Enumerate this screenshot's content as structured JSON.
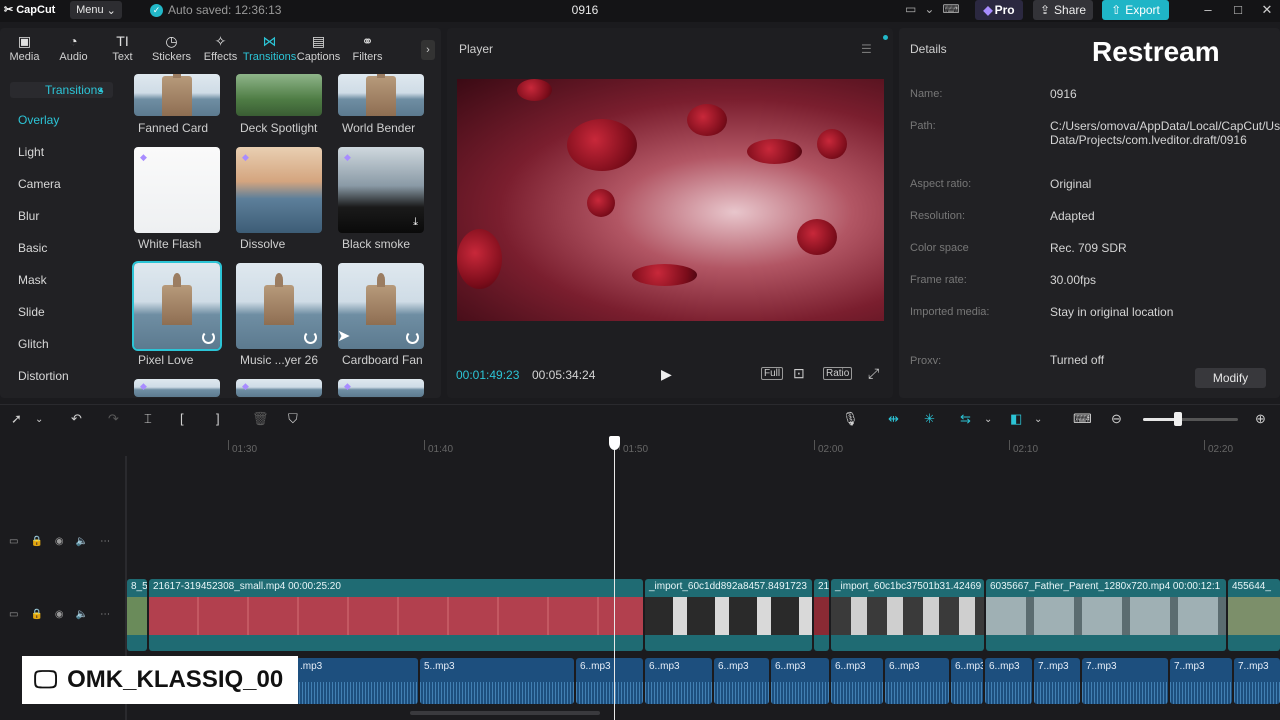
{
  "topbar": {
    "app_name": "CapCut",
    "menu_label": "Menu",
    "autosave": "Auto saved: 12:36:13",
    "project_title": "0916",
    "pro_label": "Pro",
    "share_label": "Share",
    "export_label": "Export"
  },
  "tabs": [
    {
      "label": "Media",
      "icon": "media-icon"
    },
    {
      "label": "Audio",
      "icon": "audio-icon"
    },
    {
      "label": "Text",
      "icon": "text-icon"
    },
    {
      "label": "Stickers",
      "icon": "stickers-icon"
    },
    {
      "label": "Effects",
      "icon": "effects-icon"
    },
    {
      "label": "Transitions",
      "icon": "transitions-icon"
    },
    {
      "label": "Captions",
      "icon": "captions-icon"
    },
    {
      "label": "Filters",
      "icon": "filters-icon"
    }
  ],
  "categories": {
    "header": "Transitions",
    "items": [
      "Overlay",
      "Light",
      "Camera",
      "Blur",
      "Basic",
      "Mask",
      "Slide",
      "Glitch",
      "Distortion"
    ],
    "selected": "Overlay"
  },
  "transitions": [
    {
      "label": "Fanned Card"
    },
    {
      "label": "Deck Spotlight"
    },
    {
      "label": "World Bender"
    },
    {
      "label": "White Flash"
    },
    {
      "label": "Dissolve"
    },
    {
      "label": "Black smoke"
    },
    {
      "label": "Pixel Love"
    },
    {
      "label": "Music ...yer 26"
    },
    {
      "label": "Cardboard Fan"
    }
  ],
  "player": {
    "title": "Player",
    "current_time": "00:01:49:23",
    "total_time": "00:05:34:24",
    "full_label": "Full",
    "ratio_label": "Ratio"
  },
  "details": {
    "title": "Details",
    "watermark": "Restream",
    "rows": [
      {
        "key": "Name:",
        "value": "0916"
      },
      {
        "key": "Path:",
        "value": "C:/Users/omova/AppData/Local/CapCut/User Data/Projects/com.lveditor.draft/0916"
      },
      {
        "key": "Aspect ratio:",
        "value": "Original"
      },
      {
        "key": "Resolution:",
        "value": "Adapted"
      },
      {
        "key": "Color space",
        "value": "Rec. 709 SDR"
      },
      {
        "key": "Frame rate:",
        "value": "30.00fps"
      },
      {
        "key": "Imported media:",
        "value": "Stay in original location"
      },
      {
        "key": "Proxy:",
        "value": "Turned off"
      }
    ],
    "modify_label": "Modify"
  },
  "ruler": [
    "01:30",
    "01:40",
    "01:50",
    "02:00",
    "02:10",
    "02:20"
  ],
  "video_track": [
    {
      "caption": "8_5"
    },
    {
      "caption": "21617-319452308_small.mp4   00:00:25:20"
    },
    {
      "caption": "_import_60c1dd892a8457.8491723"
    },
    {
      "caption": "21"
    },
    {
      "caption": "_import_60c1bc37501b31.42469"
    },
    {
      "caption": "6035667_Father_Parent_1280x720.mp4   00:00:12:1"
    },
    {
      "caption": "455644_"
    }
  ],
  "audio_track": [
    {
      "caption": ".mp3"
    },
    {
      "caption": "5..mp3"
    },
    {
      "caption": "6..mp3"
    },
    {
      "caption": "6..mp3"
    },
    {
      "caption": "6..mp3"
    },
    {
      "caption": "6..mp3"
    },
    {
      "caption": "6..mp3"
    },
    {
      "caption": "6..mp3"
    },
    {
      "caption": "6..mp3"
    },
    {
      "caption": "6..mp3"
    },
    {
      "caption": "7..mp3"
    },
    {
      "caption": "7..mp3"
    },
    {
      "caption": "7..mp3"
    },
    {
      "caption": "7..mp3"
    }
  ],
  "overlay_text": "OMK_KLASSIQ_00",
  "colors": {
    "accent": "#2cc4d6",
    "export": "#1fb5c7",
    "video_clip": "#1f6b73",
    "audio_clip": "#1d4f7e"
  }
}
